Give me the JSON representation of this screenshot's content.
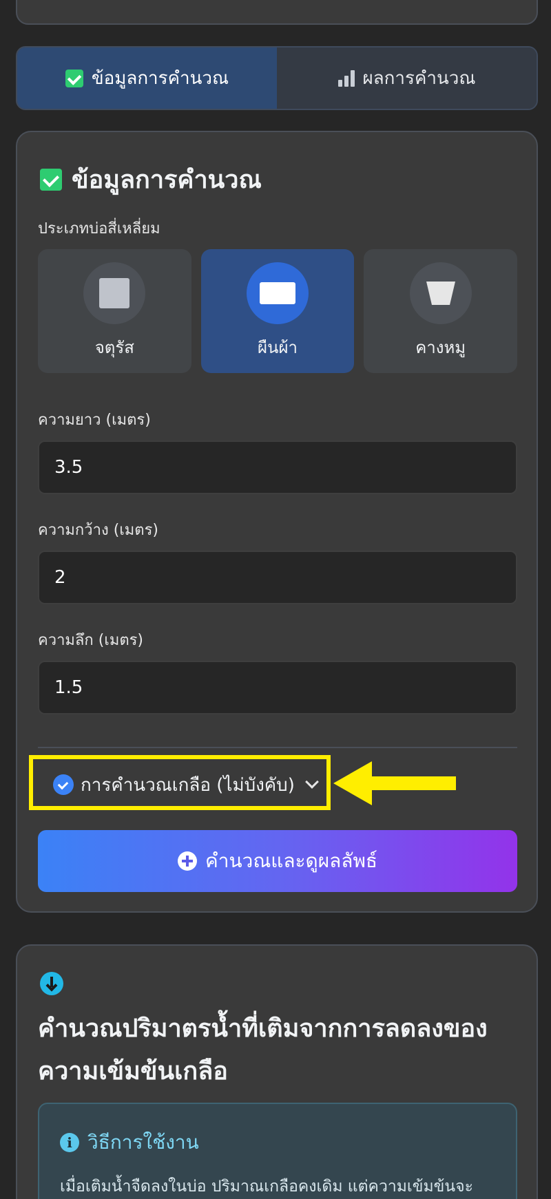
{
  "tabs": [
    {
      "label": "ข้อมูลการคำนวณ",
      "icon": "clipboard-check-icon",
      "active": true
    },
    {
      "label": "ผลการคำนวณ",
      "icon": "bar-chart-icon",
      "active": false
    }
  ],
  "form": {
    "title": "ข้อมูลการคำนวณ",
    "pond_type_label": "ประเภทบ่อสี่เหลี่ยม",
    "shapes": [
      {
        "label": "จตุรัส",
        "icon": "square-icon",
        "selected": false
      },
      {
        "label": "ผืนผ้า",
        "icon": "rectangle-icon",
        "selected": true
      },
      {
        "label": "คางหมู",
        "icon": "trapezoid-icon",
        "selected": false
      }
    ],
    "length_label": "ความยาว (เมตร)",
    "length_value": "3.5",
    "width_label": "ความกว้าง (เมตร)",
    "width_value": "2",
    "depth_label": "ความลึก (เมตร)",
    "depth_value": "1.5",
    "salt_toggle_label": "การคำนวณเกลือ (ไม่บังคับ)",
    "calculate_label": "คำนวณและดูผลลัพธ์"
  },
  "info": {
    "heading": "คำนวณปริมาตรน้ำที่เติมจากการลดลงของความเข้มข้นเกลือ",
    "howto_title": "วิธีการใช้งาน",
    "howto_text": "เมื่อเติมน้ำจืดลงในบ่อ ปริมาณเกลือคงเดิม แต่ความเข้มข้นจะ"
  },
  "colors": {
    "highlight": "#ffee00",
    "accent_blue": "#3b82f6",
    "accent_purple": "#9333ea"
  }
}
